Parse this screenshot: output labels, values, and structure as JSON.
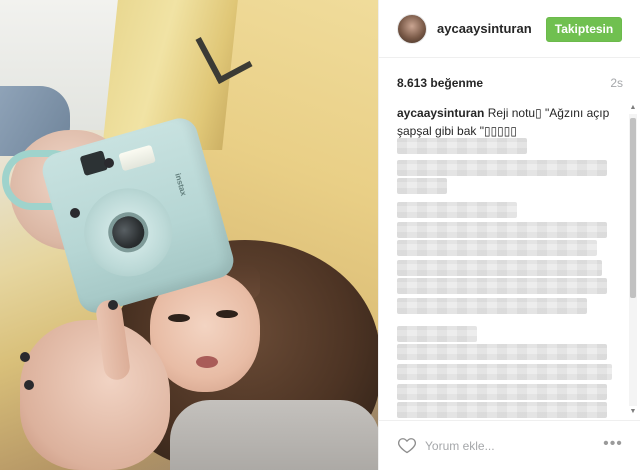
{
  "post": {
    "username": "aycaaysinturan",
    "follow_label": "Takiptesin",
    "likes": "8.613 beğenme",
    "time": "2s",
    "caption_user": "aycaaysinturan",
    "caption_text": " Reji notu▯ \"Ağzını açıp şapşal gibi bak \"▯▯▯▯▯",
    "comment_placeholder": "Yorum ekle...",
    "more_label": "•••",
    "camera_brand": "instax"
  },
  "colors": {
    "follow_bg": "#70c050",
    "text": "#262626",
    "muted": "#a5a7aa"
  },
  "icons": {
    "like": "heart-outline-icon",
    "more": "more-options-icon"
  }
}
